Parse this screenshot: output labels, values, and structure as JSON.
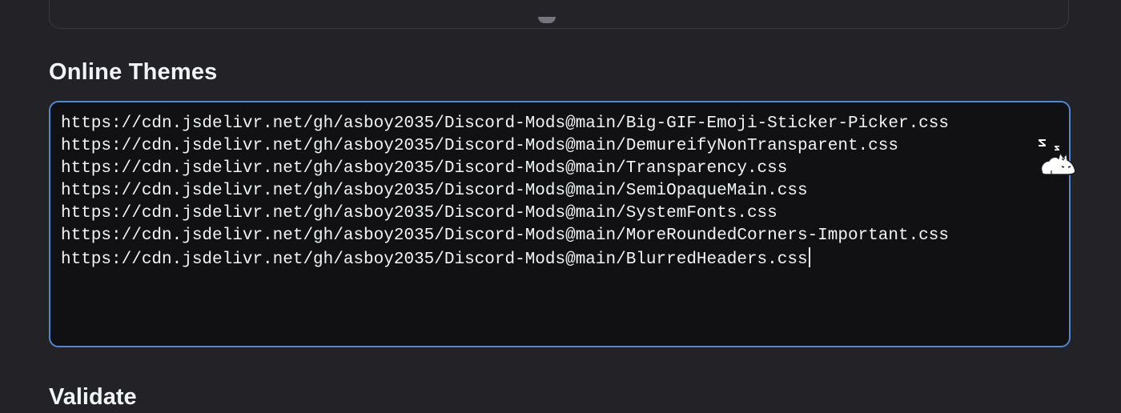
{
  "section": {
    "title": "Online Themes"
  },
  "editor": {
    "lines": [
      "https://cdn.jsdelivr.net/gh/asboy2035/Discord-Mods@main/Big-GIF-Emoji-Sticker-Picker.css",
      "https://cdn.jsdelivr.net/gh/asboy2035/Discord-Mods@main/DemureifyNonTransparent.css",
      "https://cdn.jsdelivr.net/gh/asboy2035/Discord-Mods@main/Transparency.css",
      "https://cdn.jsdelivr.net/gh/asboy2035/Discord-Mods@main/SemiOpaqueMain.css",
      "https://cdn.jsdelivr.net/gh/asboy2035/Discord-Mods@main/SystemFonts.css",
      "https://cdn.jsdelivr.net/gh/asboy2035/Discord-Mods@main/MoreRoundedCorners-Important.css",
      "https://cdn.jsdelivr.net/gh/asboy2035/Discord-Mods@main/BlurredHeaders.css"
    ]
  },
  "next_section": {
    "title": "Validate"
  },
  "decoration": {
    "icon": "sleeping-cat-icon"
  },
  "colors": {
    "background": "#222227",
    "editor_background": "#111114",
    "focus_border": "#4f86d6",
    "text": "#f2f3f5"
  }
}
